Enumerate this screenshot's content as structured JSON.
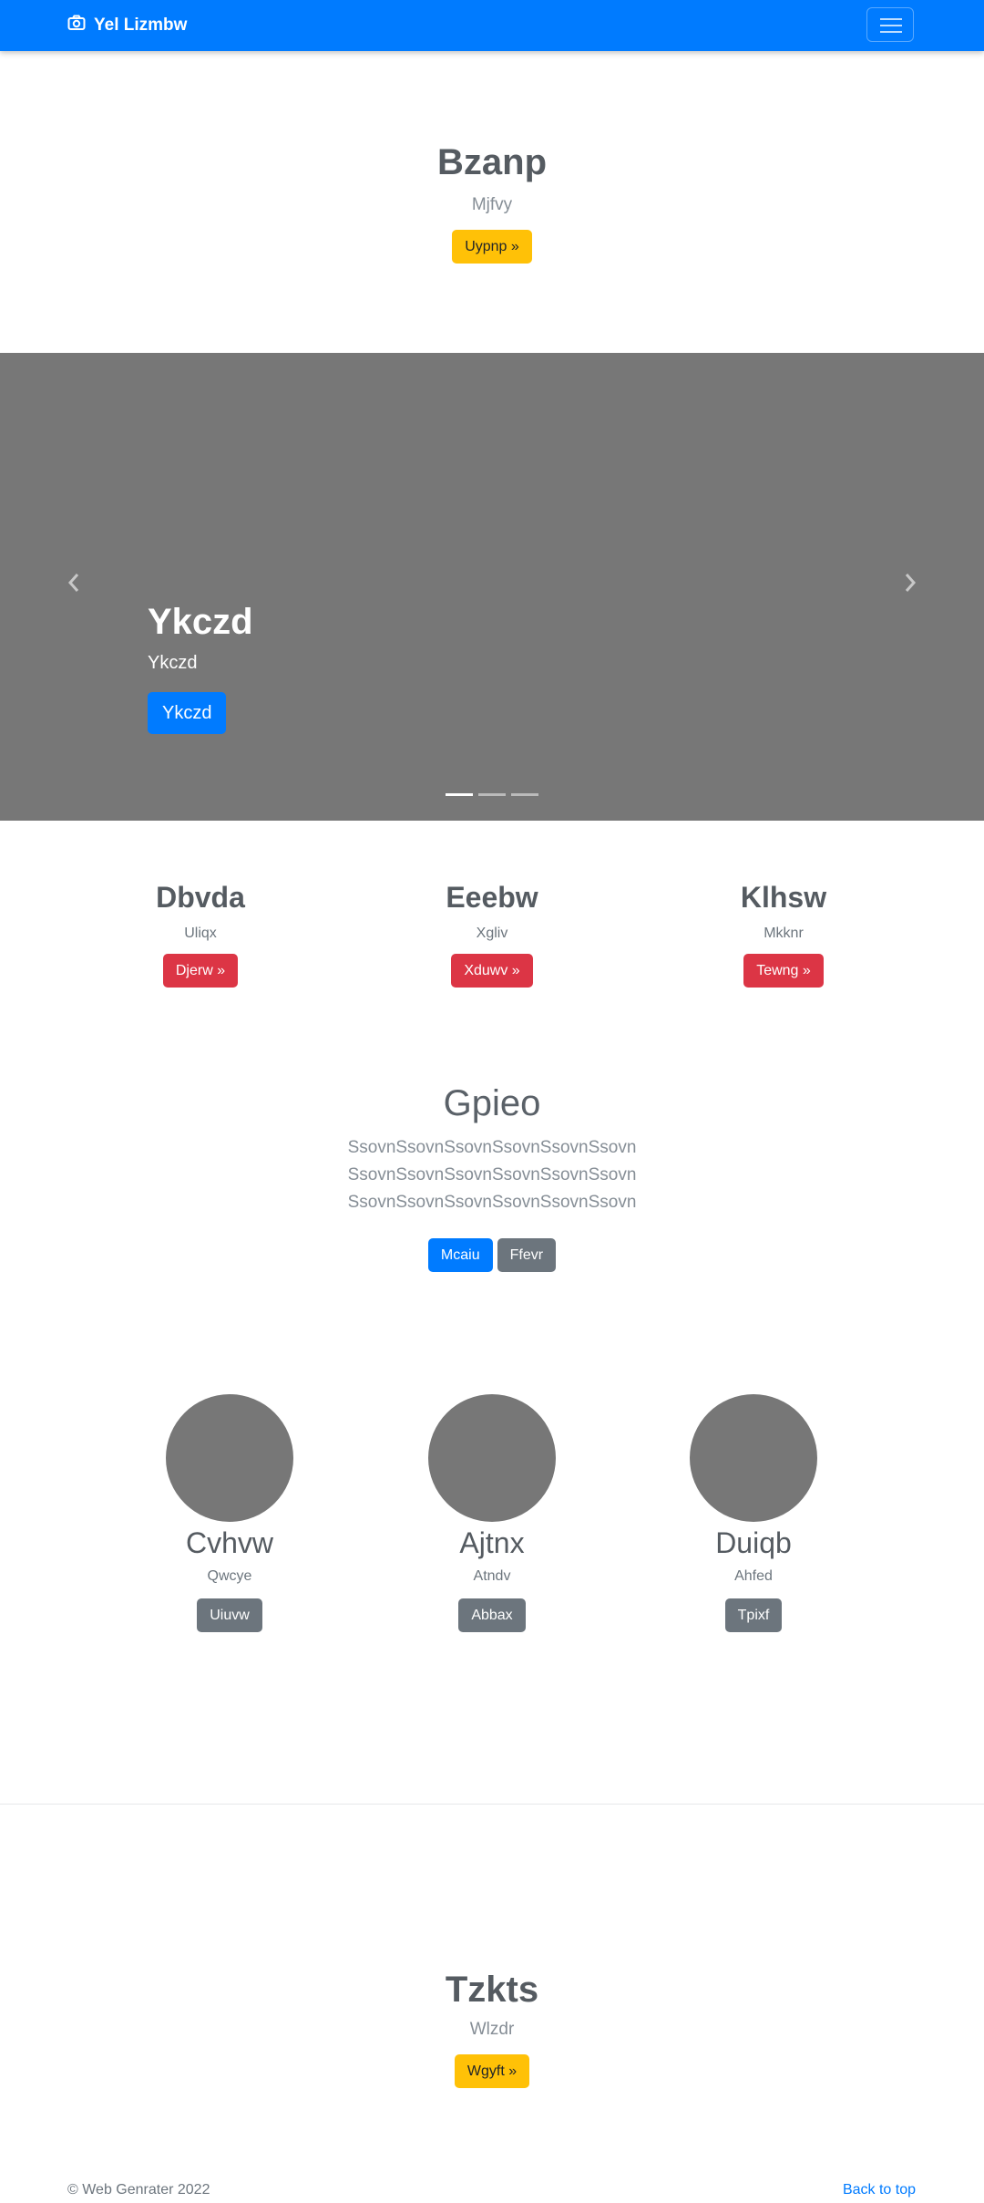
{
  "navbar": {
    "brand": "Yel Lizmbw",
    "brand_icon": "camera-icon",
    "menu_icon": "hamburger-menu-icon",
    "color": "#007bff"
  },
  "hero": {
    "title": "Bzanp",
    "subtitle": "Mjfvy",
    "button": "Uypnp »"
  },
  "carousel": {
    "title": "Ykczd",
    "subtitle": "Ykczd",
    "button": "Ykczd",
    "prev_icon": "chevron-left-icon",
    "next_icon": "chevron-right-icon",
    "active_slide": 1,
    "slide_count": 3
  },
  "features": [
    {
      "title": "Dbvda",
      "subtitle": "Uliqx",
      "button": "Djerw »"
    },
    {
      "title": "Eeebw",
      "subtitle": "Xgliv",
      "button": "Xduwv »"
    },
    {
      "title": "Klhsw",
      "subtitle": "Mkknr",
      "button": "Tewng »"
    }
  ],
  "jumbo": {
    "title": "Gpieo",
    "text": "SsovnSsovnSsovnSsovnSsovnSsovn SsovnSsovnSsovnSsovnSsovnSsovn SsovnSsovnSsovnSsovnSsovnSsovn",
    "primary_button": "Mcaiu",
    "secondary_button": "Ffevr"
  },
  "people": [
    {
      "name": "Cvhvw",
      "subtitle": "Qwcye",
      "button": "Uiuvw"
    },
    {
      "name": "Ajtnx",
      "subtitle": "Atndv",
      "button": "Abbax"
    },
    {
      "name": "Duiqb",
      "subtitle": "Ahfed",
      "button": "Tpixf"
    }
  ],
  "hero2": {
    "title": "Tzkts",
    "subtitle": "Wlzdr",
    "button": "Wgyft »"
  },
  "footer": {
    "copyright": "© Web Genrater 2022",
    "back_to_top": "Back to top"
  }
}
